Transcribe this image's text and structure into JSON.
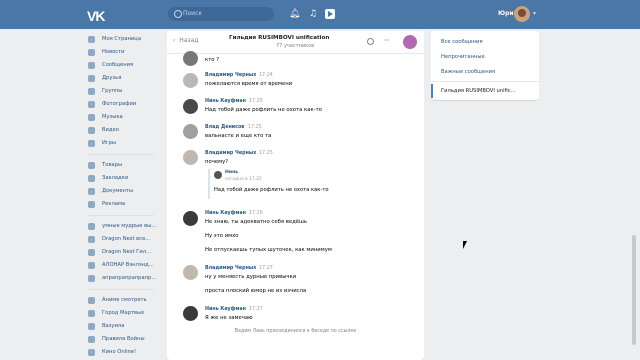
{
  "topbar": {
    "logo_text": "VK",
    "search_placeholder": "Поиск",
    "user_name": "Юрий",
    "bell_icon": "bell-icon",
    "music_icon": "music-icon",
    "play_icon": "play-icon",
    "caret": "▾"
  },
  "sidebar": {
    "groups": [
      [
        {
          "label": "Моя Страница",
          "icon": "home-icon"
        },
        {
          "label": "Новости",
          "icon": "news-icon"
        },
        {
          "label": "Сообщения",
          "icon": "messages-icon"
        },
        {
          "label": "Друзья",
          "icon": "friends-icon"
        },
        {
          "label": "Группы",
          "icon": "groups-icon"
        },
        {
          "label": "Фотографии",
          "icon": "photos-icon"
        },
        {
          "label": "Музыка",
          "icon": "music-icon"
        },
        {
          "label": "Видео",
          "icon": "video-icon"
        },
        {
          "label": "Игры",
          "icon": "games-icon"
        }
      ],
      [
        {
          "label": "Товары",
          "icon": "goods-icon"
        },
        {
          "label": "Закладки",
          "icon": "bookmarks-icon"
        },
        {
          "label": "Документы",
          "icon": "documents-icon"
        },
        {
          "label": "Реклама",
          "icon": "ads-icon"
        }
      ],
      [
        {
          "label": "умные мудрые вы...",
          "icon": "group-icon"
        },
        {
          "label": "Dragon Nest все...",
          "icon": "group-icon"
        },
        {
          "label": "Dragon Nest Гил...",
          "icon": "group-icon"
        },
        {
          "label": "АЛОНАР Вэнлэнд...",
          "icon": "group-icon"
        },
        {
          "label": "апрапрапрапрапр...",
          "icon": "group-icon"
        }
      ],
      [
        {
          "label": "Аниме смотреть",
          "icon": "app-icon"
        },
        {
          "label": "Город Мартвых",
          "icon": "app-icon"
        },
        {
          "label": "Вазуила",
          "icon": "app-icon"
        },
        {
          "label": "Правила Войны",
          "icon": "app-icon"
        },
        {
          "label": "Кино Online!",
          "icon": "app-icon"
        }
      ]
    ]
  },
  "chat": {
    "back_label": "Назад",
    "title": "Гильдия RUSIMBOVI unification",
    "subtitle": "77 участников",
    "messages": [
      {
        "author": "",
        "time": "",
        "text": "кто ?",
        "avatar_color": "#555555"
      },
      {
        "author": "Владимир Черных",
        "time": "17:24",
        "text": "пожелаются время от времени",
        "avatar_color": "#b8b8b8"
      },
      {
        "author": "Нинь Кауфман",
        "time": "17:25",
        "text": "Над тобой даже рофлить не охота как-то",
        "avatar_color": "#4a4a4a"
      },
      {
        "author": "Влад Денисов",
        "time": "17:25",
        "text": "вальнасте и еще кто та",
        "avatar_color": "#a0a0a0"
      },
      {
        "author": "Владимир Черных",
        "time": "17:25",
        "text": "почему?",
        "avatar_color": "#c0b8b0"
      },
      {
        "author": "Нинь Кауфман",
        "time": "17:26",
        "text": "Не знаю, ты адекватно себя ведёшь",
        "avatar_color": "#3a3a3a"
      },
      {
        "author": "Владимир Черных",
        "time": "17:27",
        "text": "ну у меняесть дурные привычки",
        "avatar_color": "#c0b8b0"
      },
      {
        "author": "Нинь Кауфман",
        "time": "17:27",
        "text": "Я же не замечаю",
        "avatar_color": "#3a3a3a"
      }
    ],
    "extra_lines": [
      "Ну это имхо",
      "Не отпускаешь тупых шуточек, как минимум",
      "проста плоский юмор не из изчисла"
    ],
    "quote": {
      "author": "Нинь",
      "time": "сегодня в 17:25",
      "text": "Над тобой даже рофлить не охота как-то"
    },
    "system_text": "Вадим Лавь присоединился к беседе по ссылке"
  },
  "right_panel": {
    "items": [
      "Все сообщения",
      "Непрочитанные",
      "Важные сообщения"
    ],
    "active": "Гильдия RUSIMBOVI unific..."
  },
  "colors": {
    "accent": "#4a76a8",
    "link": "#2a5885",
    "background": "#edeef0"
  }
}
